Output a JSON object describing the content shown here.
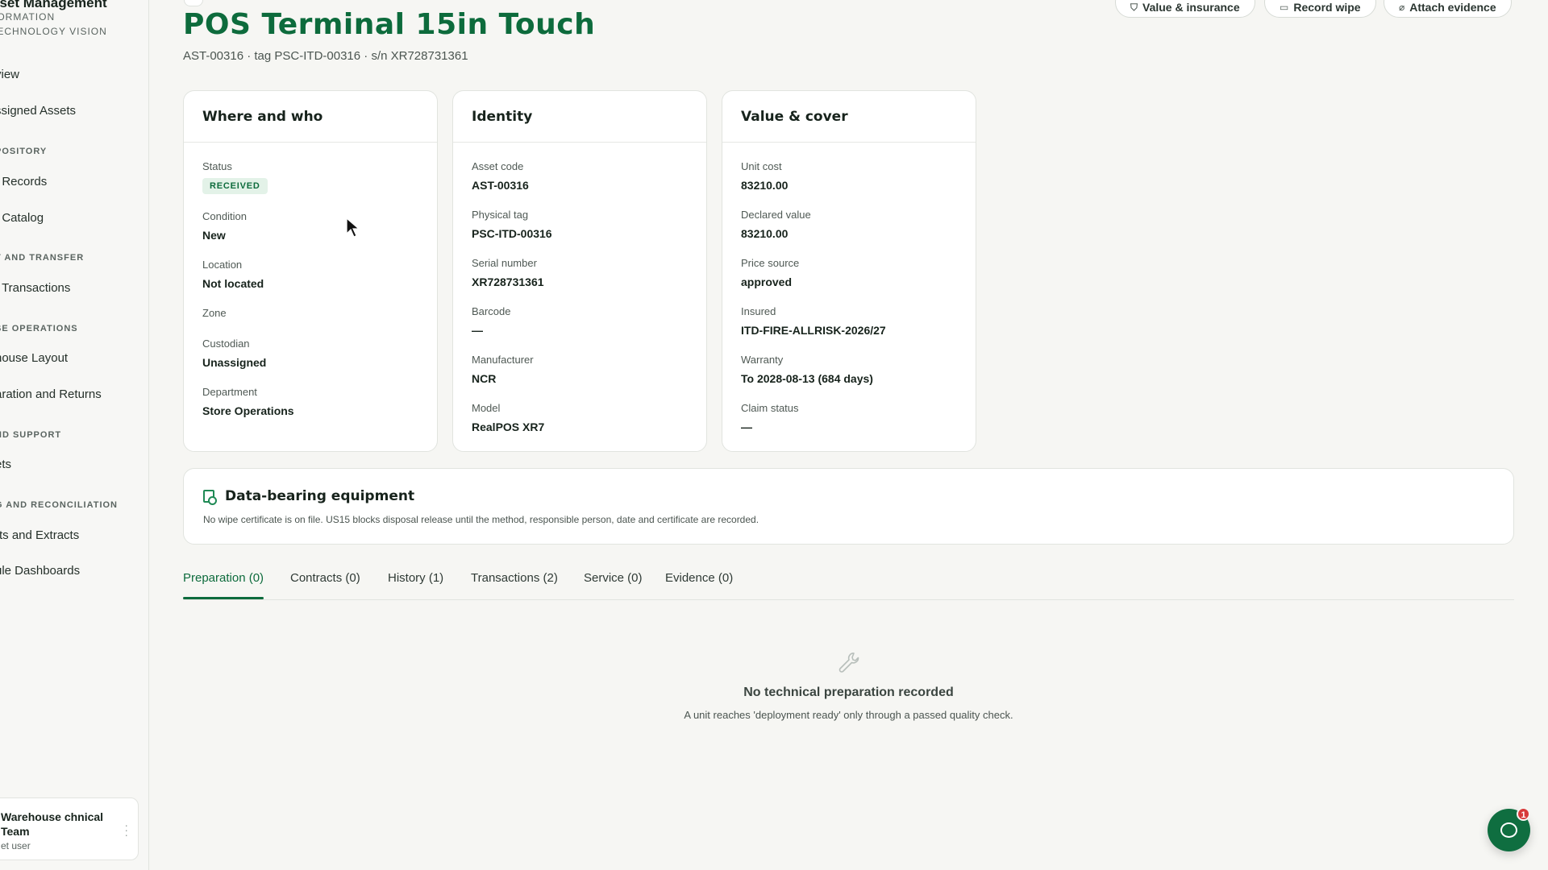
{
  "sidebar": {
    "brand_title": "sset Management",
    "brand_sub": "FORMATION TECHNOLOGY VISION",
    "items": [
      {
        "label": "view"
      },
      {
        "label": "ssigned Assets"
      },
      {
        "section": "POSITORY"
      },
      {
        "label": "t Records"
      },
      {
        "label": "t Catalog"
      },
      {
        "section": "T AND TRANSFER"
      },
      {
        "label": "t Transactions"
      },
      {
        "section": "SE OPERATIONS"
      },
      {
        "label": "house Layout"
      },
      {
        "label": "aration and Returns"
      },
      {
        "section": "ND SUPPORT"
      },
      {
        "label": "ets"
      },
      {
        "section": "G AND RECONCILIATION"
      },
      {
        "label": "rts and Extracts"
      },
      {
        "label": "ule Dashboards"
      }
    ],
    "user": {
      "name": "Warehouse chnical Team",
      "role": "et user"
    }
  },
  "header": {
    "title": "POS Terminal 15in Touch",
    "subtitle": "AST-00316 · tag PSC-ITD-00316 · s/n XR728731361",
    "buttons": {
      "value_insurance": "Value & insurance",
      "record_wipe": "Record wipe",
      "attach_evidence": "Attach evidence"
    }
  },
  "cards": {
    "where": {
      "title": "Where and who",
      "status_label": "Status",
      "status_value": "RECEIVED",
      "condition_label": "Condition",
      "condition_value": "New",
      "location_label": "Location",
      "location_value": "Not located",
      "zone_label": "Zone",
      "zone_value": "",
      "custodian_label": "Custodian",
      "custodian_value": "Unassigned",
      "department_label": "Department",
      "department_value": "Store Operations"
    },
    "identity": {
      "title": "Identity",
      "asset_code_label": "Asset code",
      "asset_code_value": "AST-00316",
      "physical_tag_label": "Physical tag",
      "physical_tag_value": "PSC-ITD-00316",
      "serial_label": "Serial number",
      "serial_value": "XR728731361",
      "barcode_label": "Barcode",
      "barcode_value": "—",
      "manufacturer_label": "Manufacturer",
      "manufacturer_value": "NCR",
      "model_label": "Model",
      "model_value": "RealPOS XR7"
    },
    "value": {
      "title": "Value & cover",
      "unit_cost_label": "Unit cost",
      "unit_cost_value": "83210.00",
      "declared_label": "Declared value",
      "declared_value": "83210.00",
      "price_source_label": "Price source",
      "price_source_value": "approved",
      "insured_label": "Insured",
      "insured_value": "ITD-FIRE-ALLRISK-2026/27",
      "warranty_label": "Warranty",
      "warranty_value": "To 2028-08-13 (684 days)",
      "claim_label": "Claim status",
      "claim_value": "—"
    }
  },
  "data_bearing": {
    "title": "Data-bearing equipment",
    "text": "No wipe certificate is on file. US15 blocks disposal release until the method, responsible person, date and certificate are recorded."
  },
  "tabs": [
    {
      "label": "Preparation (0)"
    },
    {
      "label": "Contracts (0)"
    },
    {
      "label": "History (1)"
    },
    {
      "label": "Transactions (2)"
    },
    {
      "label": "Service (0)"
    },
    {
      "label": "Evidence (0)"
    }
  ],
  "empty_state": {
    "title": "No technical preparation recorded",
    "text": "A unit reaches 'deployment ready' only through a passed quality check."
  },
  "chat": {
    "badge": "1"
  },
  "colors": {
    "accent": "#0d6b3c",
    "badge_bg": "#e3f2e8",
    "alert": "#d73a3a"
  }
}
